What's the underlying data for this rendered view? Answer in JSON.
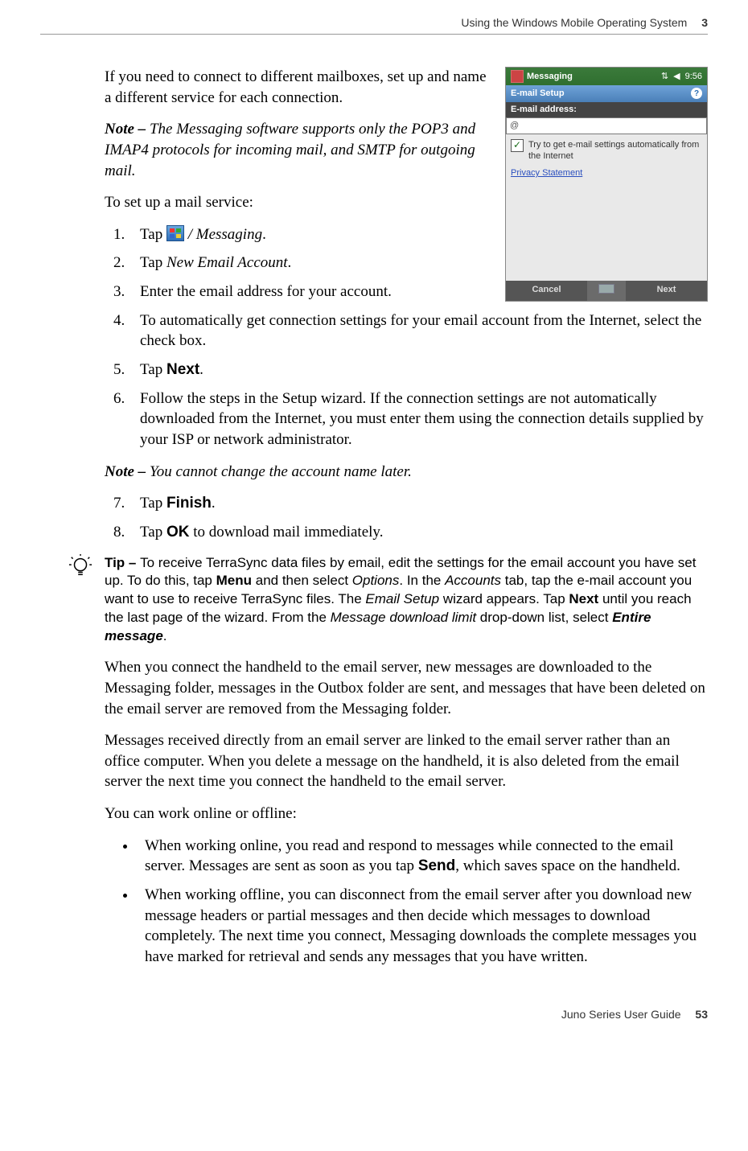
{
  "header": {
    "title": "Using the Windows Mobile Operating System",
    "chapter": "3"
  },
  "intro": " If you need to connect to different mailboxes, set up and name a different service for each connection.",
  "note1": {
    "label": "Note – ",
    "text": "The Messaging software supports only the POP3 and IMAP4 protocols for incoming mail, and SMTP for outgoing mail."
  },
  "setup_lead": "To set up a mail service:",
  "steps_a": [
    {
      "pre": "Tap ",
      "ital": " / Messaging",
      "post": "."
    },
    {
      "pre": "Tap ",
      "ital": "New Email Account",
      "post": "."
    },
    {
      "plain": "Enter the email address for your account."
    },
    {
      "plain": "To automatically get connection settings for your email account from the Internet, select the check box."
    },
    {
      "pre": "Tap ",
      "bold": "Next",
      "post": "."
    },
    {
      "plain": "Follow the steps in the Setup wizard. If the connection settings are not automatically downloaded from the Internet, you must enter them using the connection details supplied by your ISP or network administrator."
    }
  ],
  "note2": {
    "label": "Note – ",
    "text": "You cannot change the account name later."
  },
  "steps_b_start": 7,
  "steps_b": [
    {
      "pre": "Tap ",
      "bold": "Finish",
      "post": "."
    },
    {
      "pre": "Tap ",
      "bold": "OK",
      "post_plain": " to download mail immediately."
    }
  ],
  "tip": {
    "label": "Tip – ",
    "t1": "To receive TerraSync data files by email, edit the settings for the email account you have set up. To do this, tap ",
    "b1": "Menu",
    "t2": " and then select ",
    "i1": "Options",
    "t3": ". In the ",
    "i2": "Accounts",
    "t4": " tab, tap the e-mail account you want to use to receive TerraSync files. The ",
    "i3": "Email Setup",
    "t5": " wizard appears. Tap ",
    "b2": "Next",
    "t6": " until you reach the last page of the wizard. From the ",
    "i4": "Message download limit",
    "t7": " drop-down list, select ",
    "bi": "Entire message",
    "t8": "."
  },
  "para1": "When you connect the handheld to the email server, new messages are downloaded to the Messaging folder, messages in the Outbox folder are sent, and messages that have been deleted on the email server are removed from the Messaging folder.",
  "para2": "Messages received directly from an email server are linked to the email server rather than an office computer. When you delete a message on the handheld, it is also deleted from the email server the next time you connect the handheld to the email server.",
  "para3": "You can work online or offline:",
  "bullets": [
    {
      "pre": "When working online, you read and respond to messages while connected to the email server. Messages are sent as soon as you tap ",
      "bold": "Send",
      "post": ", which saves space on the handheld."
    },
    {
      "plain": "When working offline, you can disconnect from the email server after you download new message headers or partial messages and then decide which messages to download completely. The next time you connect, Messaging downloads the complete messages you have marked for retrieval and sends any messages that you have written."
    }
  ],
  "screenshot": {
    "titlebar": "Messaging",
    "time": "9:56",
    "subtitle": "E-mail Setup",
    "field_label": "E-mail address:",
    "field_value": "@",
    "checkbox_label": "Try to get e-mail settings automatically from the Internet",
    "link": "Privacy Statement",
    "btn_left": "Cancel",
    "btn_right": "Next"
  },
  "footer": {
    "guide": "Juno Series User Guide",
    "page": "53"
  }
}
